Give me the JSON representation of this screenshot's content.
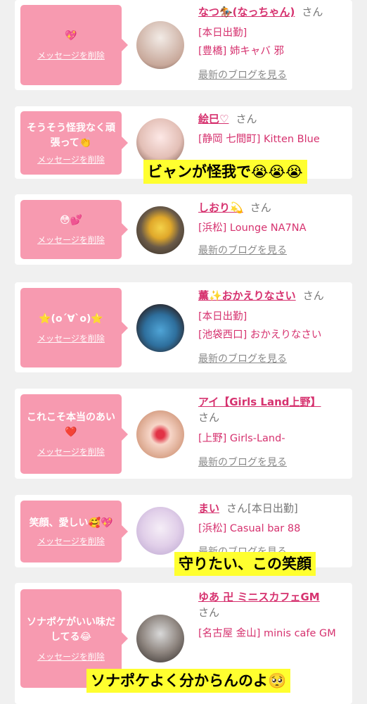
{
  "entries": [
    {
      "message": "💖",
      "delete_label": "メッセージを削除",
      "name": "なつ🏇(なっちゃん)",
      "san": "さん",
      "lines": [
        "[本日出勤]",
        "[豊橋] 姉キャバ 邪"
      ],
      "blog": "最新のブログを見る",
      "avatar_colors": [
        "#f2ebe6",
        "#c8a89a"
      ]
    },
    {
      "message": "そうそう怪我なく頑張って👏",
      "delete_label": "メッセージを削除",
      "name": "絵巳♡",
      "san": "さん",
      "lines": [
        "[静岡 七間町] Kitten Blue"
      ],
      "blog": "",
      "avatar_colors": [
        "#fde8e6",
        "#b98a7a"
      ]
    },
    {
      "message": "😳💕",
      "delete_label": "メッセージを削除",
      "name": "しおり💫",
      "san": "さん",
      "lines": [
        "[浜松] Lounge NA7NA"
      ],
      "blog": "最新のブログを見る",
      "avatar_colors": [
        "#f4d24a",
        "#3d342c"
      ]
    },
    {
      "message": "⭐(o´∀`o)⭐",
      "delete_label": "メッセージを削除",
      "name": "薫✨おかえりなさい",
      "san": "さん",
      "lines": [
        "[本日出勤]",
        "[池袋西口] おかえりなさい"
      ],
      "blog": "最新のブログを見る",
      "avatar_colors": [
        "#4fa4d6",
        "#2a2326"
      ]
    },
    {
      "message": "これこそ本当のあい❤️",
      "delete_label": "メッセージを削除",
      "name": "アイ【Girls Land上野】",
      "san": "さん",
      "lines": [
        "[上野] Girls-Land-"
      ],
      "blog": "最新のブログを見る",
      "avatar_colors": [
        "#f7d6c8",
        "#e23346"
      ]
    },
    {
      "message": "笑顔、愛しい🥰💖",
      "delete_label": "メッセージを削除",
      "name": "まい",
      "san": "さん[本日出勤]",
      "lines": [
        "[浜松] Casual bar 88"
      ],
      "blog": "最新のブログを見る",
      "avatar_colors": [
        "#e9dcef",
        "#c7b6d9"
      ]
    },
    {
      "message": "ソナポケがいい味だしてる😂",
      "delete_label": "メッセージを削除",
      "name": "ゆあ 卍 ミニスカフェGM",
      "san": "さん",
      "lines": [
        "[名古屋 金山] minis cafe GM"
      ],
      "blog": "",
      "avatar_colors": [
        "#d9d9d9",
        "#2f2a28"
      ]
    }
  ],
  "captions": [
    "ビャンが怪我で😭😭😭",
    "守りたい、この笑顔",
    "ソナポケよく分からんのよ🥺"
  ]
}
